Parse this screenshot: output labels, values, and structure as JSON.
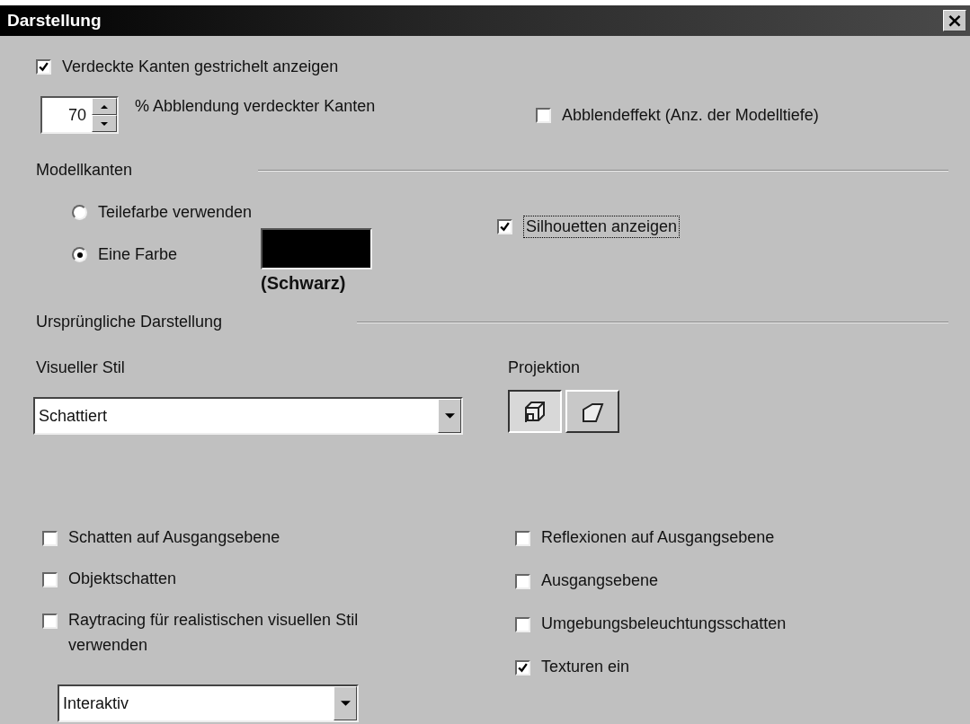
{
  "window": {
    "title": "Darstellung",
    "close": "×"
  },
  "hidden_edges": {
    "label": "Verdeckte Kanten gestrichelt anzeigen",
    "checked": true
  },
  "dimming": {
    "value": "70",
    "label": "% Abblendung verdeckter Kanten"
  },
  "fade_effect": {
    "label": "Abblendeffekt (Anz. der Modelltiefe)",
    "checked": false
  },
  "model_edges": {
    "heading": "Modellkanten",
    "options": [
      {
        "label": "Teilefarbe verwenden",
        "selected": false
      },
      {
        "label": "Eine Farbe",
        "selected": true
      }
    ],
    "color": "#000000",
    "color_name": "(Schwarz)",
    "silhouettes": {
      "label": "Silhouetten anzeigen",
      "checked": true
    }
  },
  "initial_display": {
    "heading": "Ursprüngliche Darstellung",
    "visual_style": {
      "label": "Visueller Stil",
      "value": "Schattiert"
    },
    "projection": {
      "label": "Projektion",
      "options": [
        {
          "kind": "perspective",
          "selected": true
        },
        {
          "kind": "parallel",
          "selected": false
        }
      ]
    }
  },
  "options_left": [
    {
      "label": "Schatten auf Ausgangsebene",
      "checked": false
    },
    {
      "label": "Objektschatten",
      "checked": false
    },
    {
      "label": "Raytracing für realistischen visuellen Stil verwenden",
      "checked": false
    }
  ],
  "raytracing_mode": "Interaktiv",
  "options_right": [
    {
      "label": "Reflexionen auf Ausgangsebene",
      "checked": false
    },
    {
      "label": "Ausgangsebene",
      "checked": false
    },
    {
      "label": "Umgebungsbeleuchtungsschatten",
      "checked": false
    },
    {
      "label": "Texturen ein",
      "checked": true
    }
  ]
}
